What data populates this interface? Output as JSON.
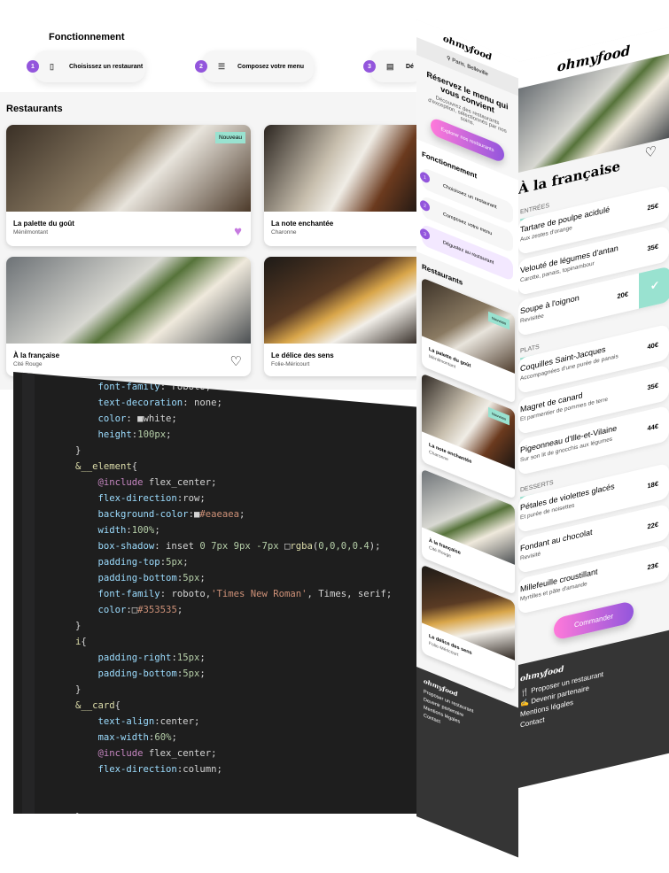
{
  "desktop": {
    "how_title": "Fonctionnement",
    "steps": [
      {
        "num": "1",
        "icon": "phone-icon",
        "label": "Choisissez un restaurant"
      },
      {
        "num": "2",
        "icon": "list-icon",
        "label": "Composez votre menu"
      },
      {
        "num": "3",
        "icon": "store-icon",
        "label": "Dé"
      }
    ],
    "restaurants_title": "Restaurants",
    "cards": [
      {
        "name": "La palette du goût",
        "area": "Ménilmontant",
        "badge": "Nouveau",
        "liked": true
      },
      {
        "name": "La note enchantée",
        "area": "Charonne",
        "badge": "",
        "liked": false
      },
      {
        "name": "À la française",
        "area": "Cité Rouge",
        "badge": "",
        "liked": false
      },
      {
        "name": "Le délice des sens",
        "area": "Folie-Méricourt",
        "badge": "",
        "liked": false
      }
    ]
  },
  "mobile_home": {
    "logo": "ohmyfood",
    "location": "Paris, Belleville",
    "hero_title": "Réservez le menu qui vous convient",
    "hero_text": "Découvrez des restaurants d'exception, sélectionnés par nos soins.",
    "cta": "Explorer nos restaurants",
    "how_title": "Fonctionnement",
    "steps": [
      {
        "num": "1",
        "label": "Choisissez un restaurant"
      },
      {
        "num": "2",
        "label": "Composez votre menu"
      },
      {
        "num": "3",
        "label": "Dégustez au restaurant"
      }
    ],
    "restaurants_title": "Restaurants",
    "cards": [
      {
        "name": "La palette du goût",
        "area": "Ménilmontant",
        "badge": "Nouveau"
      },
      {
        "name": "La note enchantée",
        "area": "Charonne",
        "badge": "Nouveau"
      },
      {
        "name": "À la française",
        "area": "Cité Rouge"
      },
      {
        "name": "Le délice des sens",
        "area": "Folie-Méricourt"
      }
    ],
    "footer": {
      "logo": "ohmyfood",
      "links": [
        "Proposer un restaurant",
        "Devenir partenaire",
        "Mentions légales",
        "Contact"
      ]
    }
  },
  "mobile_menu": {
    "logo": "ohmyfood",
    "title": "À la française",
    "sections": [
      {
        "name": "ENTRÉES",
        "dishes": [
          {
            "name": "Tartare de poulpe acidulé",
            "desc": "Aux zestes d'orange",
            "price": "25€"
          },
          {
            "name": "Velouté de légumes d'antan",
            "desc": "Carotte, panais, topinambour",
            "price": "35€"
          },
          {
            "name": "Soupe à l'oignon",
            "desc": "Revisitée",
            "price": "20€",
            "selected": true
          }
        ]
      },
      {
        "name": "PLATS",
        "dishes": [
          {
            "name": "Coquilles Saint-Jacques",
            "desc": "Accompagnées d'une purée de panais",
            "price": "40€"
          },
          {
            "name": "Magret de canard",
            "desc": "Et parmentier de pommes de terre",
            "price": "35€"
          },
          {
            "name": "Pigeonneau d'Ille-et-Vilaine",
            "desc": "Sur son lit de gnocchis aux légumes",
            "price": "44€"
          }
        ]
      },
      {
        "name": "DESSERTS",
        "dishes": [
          {
            "name": "Pétales de violettes glacés",
            "desc": "Et purée de noisettes",
            "price": "18€"
          },
          {
            "name": "Fondant au chocolat",
            "desc": "Revisité",
            "price": "22€"
          },
          {
            "name": "Millefeuille croustillant",
            "desc": "Myrtilles et pâte d'amande",
            "price": "23€"
          }
        ]
      }
    ],
    "order": "Commander",
    "footer": {
      "logo": "ohmyfood",
      "links": [
        "Proposer un restaurant",
        "Devenir partenaire",
        "Mentions légales",
        "Contact"
      ]
    }
  },
  "colors": {
    "primary": "#9356DC",
    "secondary": "#FF79DA",
    "tertiary": "#99E2D0",
    "footer": "#353535"
  }
}
